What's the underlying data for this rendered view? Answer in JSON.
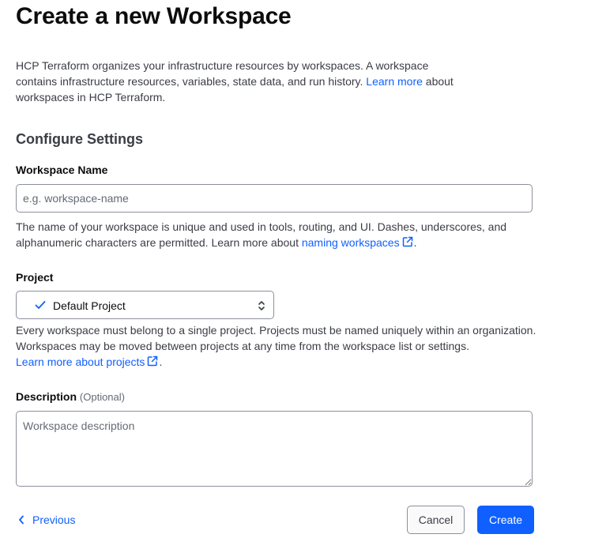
{
  "page": {
    "title": "Create a new Workspace",
    "intro_text": "HCP Terraform organizes your infrastructure resources by workspaces. A workspace contains infrastructure resources, variables, state data, and run history.",
    "intro_link": "Learn more",
    "intro_suffix": "about workspaces in HCP Terraform."
  },
  "settings": {
    "section_title": "Configure Settings",
    "workspace_name": {
      "label": "Workspace Name",
      "placeholder": "e.g. workspace-name",
      "value": "",
      "helper_text": "The name of your workspace is unique and used in tools, routing, and UI. Dashes, underscores, and alphanumeric characters are permitted. Learn more about",
      "helper_link": "naming workspaces",
      "helper_suffix": "."
    },
    "project": {
      "label": "Project",
      "selected": "Default Project",
      "helper_text": "Every workspace must belong to a single project. Projects must be named uniquely within an organization. Workspaces may be moved between projects at any time from the workspace list or settings.",
      "helper_link": "Learn more about projects",
      "helper_suffix": "."
    },
    "description": {
      "label": "Description",
      "optional": "(Optional)",
      "placeholder": "Workspace description",
      "value": ""
    }
  },
  "footer": {
    "previous_label": "Previous",
    "cancel_label": "Cancel",
    "create_label": "Create"
  },
  "colors": {
    "accent": "#1060ff",
    "text_primary": "#0c0c0e",
    "text_secondary": "#3b3d45",
    "border": "#8c909c"
  },
  "icons": {
    "check": "check-icon",
    "select_chevron": "chevron-up-down-icon",
    "external_link": "external-link-icon",
    "previous": "chevron-left-icon"
  }
}
